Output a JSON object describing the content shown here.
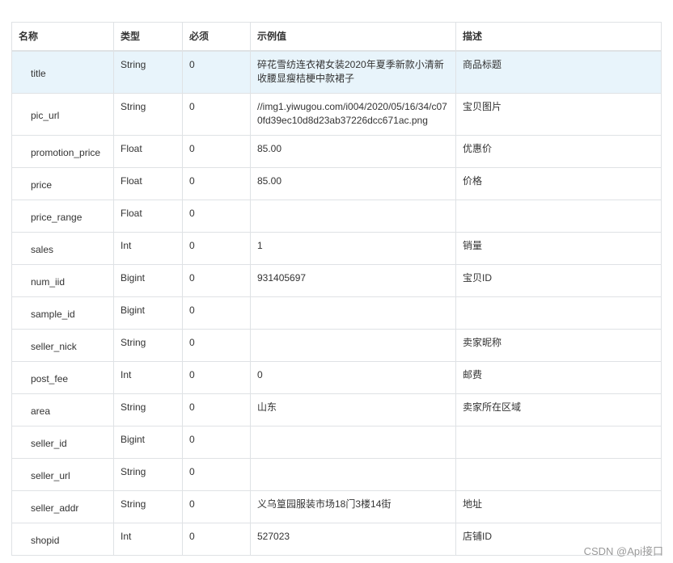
{
  "table": {
    "headers": [
      "名称",
      "类型",
      "必须",
      "示例值",
      "描述"
    ],
    "rows": [
      [
        "title",
        "String",
        "0",
        "碎花雪纺连衣裙女装2020年夏季新款小清新收腰显瘦桔梗中款裙子",
        "商品标题"
      ],
      [
        "pic_url",
        "String",
        "0",
        "//img1.yiwugou.com/i004/2020/05/16/34/c070fd39ec10d8d23ab37226dcc671ac.png",
        "宝贝图片"
      ],
      [
        "promotion_price",
        "Float",
        "0",
        "85.00",
        "优惠价"
      ],
      [
        "price",
        "Float",
        "0",
        "85.00",
        "价格"
      ],
      [
        "price_range",
        "Float",
        "0",
        "",
        ""
      ],
      [
        "sales",
        "Int",
        "0",
        "1",
        "销量"
      ],
      [
        "num_iid",
        "Bigint",
        "0",
        "931405697",
        "宝贝ID"
      ],
      [
        "sample_id",
        "Bigint",
        "0",
        "",
        ""
      ],
      [
        "seller_nick",
        "String",
        "0",
        "",
        "卖家昵称"
      ],
      [
        "post_fee",
        "Int",
        "0",
        "0",
        "邮费"
      ],
      [
        "area",
        "String",
        "0",
        "山东",
        "卖家所在区域"
      ],
      [
        "seller_id",
        "Bigint",
        "0",
        "",
        ""
      ],
      [
        "seller_url",
        "String",
        "0",
        "",
        ""
      ],
      [
        "seller_addr",
        "String",
        "0",
        "义乌篁园服装市场18门3楼14街",
        "地址"
      ],
      [
        "shopid",
        "Int",
        "0",
        "527023",
        "店铺ID"
      ]
    ]
  },
  "watermark": "CSDN @Api接口",
  "colors": {
    "border": "#dfe2e5",
    "highlight_row": "#e8f4fb",
    "text": "#333333",
    "watermark": "#9a9a9a"
  }
}
